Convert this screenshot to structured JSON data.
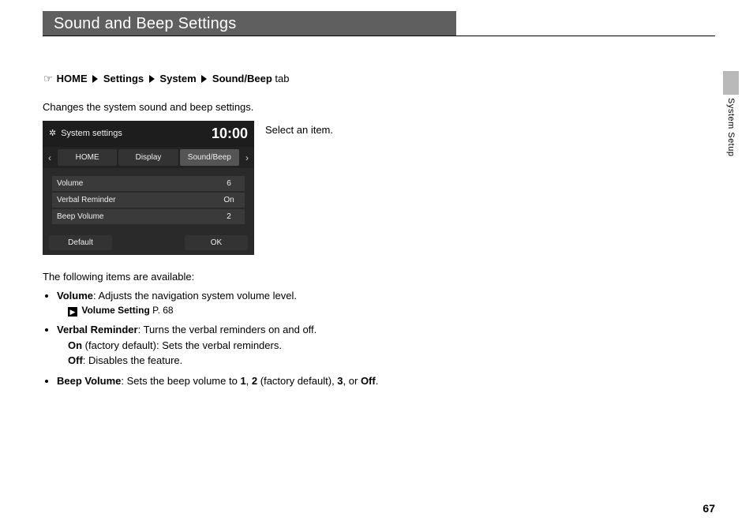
{
  "page_title": "Sound and Beep Settings",
  "section_label": "System Setup",
  "page_number": "67",
  "breadcrumb": {
    "hand_glyph": "☞",
    "items": [
      "HOME",
      "Settings",
      "System",
      "Sound/Beep"
    ],
    "suffix": " tab"
  },
  "intro_text": "Changes the system sound and beep settings.",
  "instruction_text": "Select an item.",
  "device": {
    "header_title": "System settings",
    "gear_glyph": "✲",
    "time": "10:00",
    "arrow_left": "‹",
    "arrow_right": "›",
    "tabs": [
      "HOME",
      "Display",
      "Sound/Beep"
    ],
    "active_tab_index": 2,
    "rows": [
      {
        "label": "Volume",
        "value": "6"
      },
      {
        "label": "Verbal Reminder",
        "value": "On"
      },
      {
        "label": "Beep Volume",
        "value": "2"
      }
    ],
    "footer_left": "Default",
    "footer_right": "OK"
  },
  "available_intro": "The following items are available:",
  "bullets": {
    "volume": {
      "name": "Volume",
      "desc": ": Adjusts the navigation system volume level.",
      "link_label": "Volume Setting",
      "link_page": " P. 68",
      "link_icon": "▶"
    },
    "verbal": {
      "name": "Verbal Reminder",
      "desc": ": Turns the verbal reminders on and off.",
      "on_label": "On",
      "on_desc": " (factory default): Sets the verbal reminders.",
      "off_label": "Off",
      "off_desc": ": Disables the feature."
    },
    "beep": {
      "name": "Beep Volume",
      "desc_pre": ": Sets the beep volume to ",
      "v1": "1",
      "c1": ", ",
      "v2": "2",
      "c2": " (factory default), ",
      "v3": "3",
      "c3": ", or ",
      "v4": "Off",
      "c4": "."
    }
  }
}
